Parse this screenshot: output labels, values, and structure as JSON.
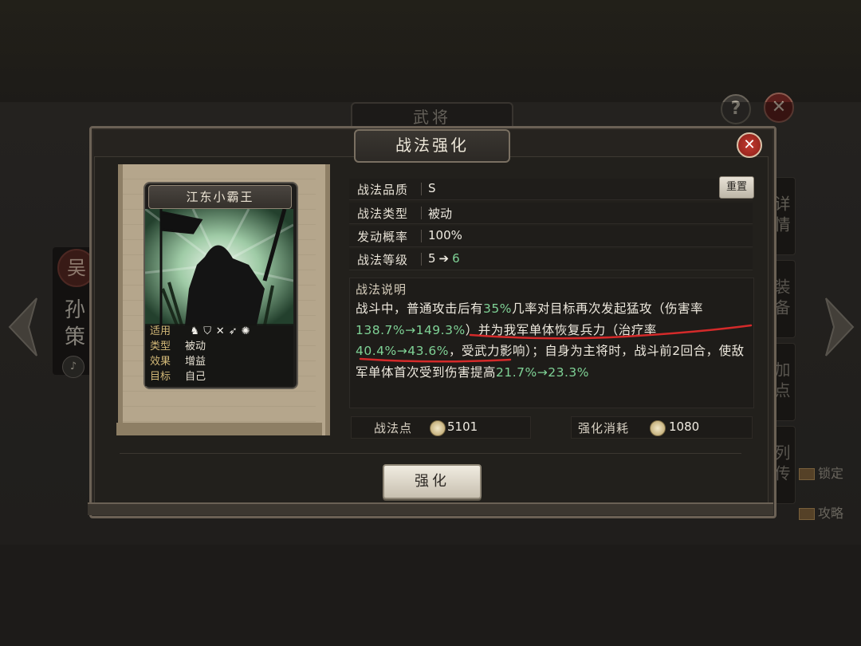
{
  "background": {
    "title": "武将",
    "help_label": "?",
    "close_label": "✕",
    "kingdom": "吴",
    "hero_name": "孙策",
    "voice_icon": "speaker-icon",
    "side_tabs": [
      "详情",
      "装备",
      "加点",
      "列传"
    ],
    "lock_label": "锁定",
    "guide_label": "攻略"
  },
  "modal": {
    "title": "战法强化",
    "close_label": "✕",
    "reset_label": "重置",
    "card": {
      "name": "江东小霸王",
      "stats": [
        {
          "key": "适用",
          "value": ""
        },
        {
          "key": "类型",
          "value": "被动"
        },
        {
          "key": "效果",
          "value": "增益"
        },
        {
          "key": "目标",
          "value": "自己"
        }
      ],
      "troop_icons": [
        "cavalry-icon",
        "shield-icon",
        "bow-icon",
        "spear-icon",
        "wheel-icon"
      ]
    },
    "info": {
      "quality_key": "战法品质",
      "quality_val": "S",
      "type_key": "战法类型",
      "type_val": "被动",
      "rate_key": "发动概率",
      "rate_val": "100%",
      "level_key": "战法等级",
      "level_from": "5",
      "level_arrow": "➔",
      "level_to": "6"
    },
    "description": {
      "label": "战法说明",
      "t1": "战斗中，普通攻击后有",
      "v1": "35%",
      "t2": "几率对目标再次发起猛攻（伤害率",
      "v2": "138.7%→149.3%",
      "t3": "）并为我军单体恢复兵力（治疗率",
      "v3": "40.4%→43.6%",
      "t4": "，受武力影响）；自身为主将时，战斗前2回合，使敌军单体首次受到伤害提高",
      "v4": "21.7%→23.3%"
    },
    "points_label": "战法点",
    "points_value": "5101",
    "cost_label": "强化消耗",
    "cost_value": "1080",
    "enhance_label": "强化"
  }
}
